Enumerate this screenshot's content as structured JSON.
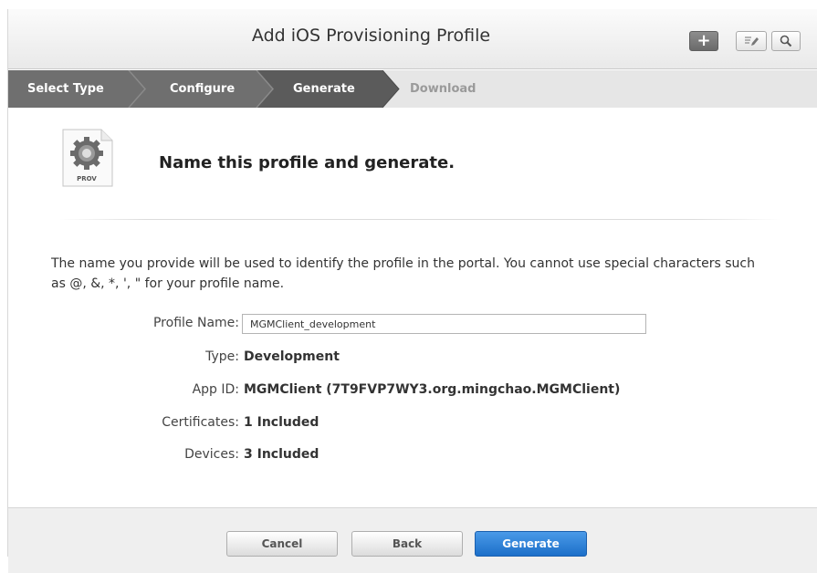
{
  "header": {
    "title": "Add iOS Provisioning Profile",
    "add_icon": "plus-icon",
    "edit_icon": "edit-icon",
    "search_icon": "search-icon"
  },
  "steps": [
    {
      "label": "Select Type",
      "state": "done"
    },
    {
      "label": "Configure",
      "state": "done"
    },
    {
      "label": "Generate",
      "state": "current"
    },
    {
      "label": "Download",
      "state": "upcoming"
    }
  ],
  "content": {
    "icon_label": "PROV",
    "heading": "Name this profile and generate.",
    "intro": "The name you provide will be used to identify the profile in the portal. You cannot use special characters such as @, &, *, ', \" for your profile name.",
    "fields": {
      "profile_name": {
        "label": "Profile Name:",
        "value": "MGMClient_development"
      },
      "type": {
        "label": "Type:",
        "value": "Development"
      },
      "app_id": {
        "label": "App ID:",
        "value": "MGMClient (7T9FVP7WY3.org.mingchao.MGMClient)"
      },
      "certificates": {
        "label": "Certificates:",
        "value": "1 Included"
      },
      "devices": {
        "label": "Devices:",
        "value": "3 Included"
      }
    }
  },
  "footer": {
    "cancel_label": "Cancel",
    "back_label": "Back",
    "generate_label": "Generate"
  },
  "colors": {
    "step_done": "#6f6f6f",
    "step_current": "#5a5a5a",
    "step_upcoming": "#e6e6e6",
    "primary_button": "#2a7fd6"
  }
}
